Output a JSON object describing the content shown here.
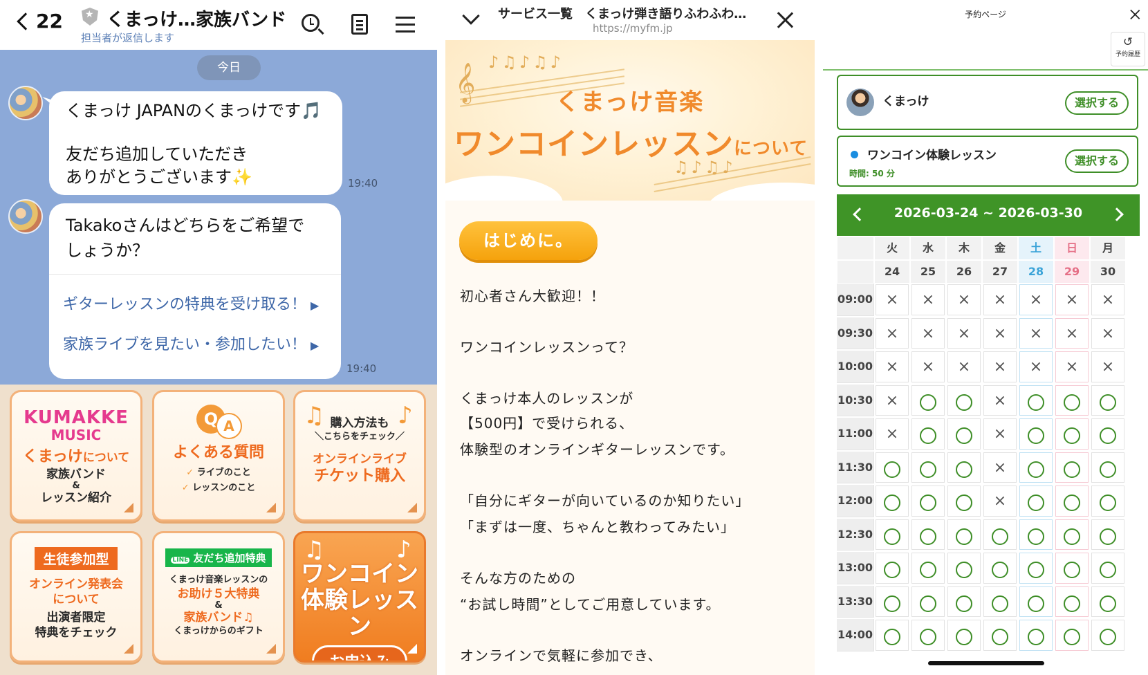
{
  "chat": {
    "unread_count": "22",
    "title": "くまっけ…家族バンド",
    "subtitle": "担当者が返信します",
    "date_label": "今日",
    "messages": [
      {
        "lines": [
          "くまっけ JAPANのくまっけです🎵",
          "友だち追加していただき",
          "ありがとうございます✨"
        ],
        "time": "19:40"
      },
      {
        "question_lines": [
          "Takakoさんはどちらをご希望で",
          "しょうか？"
        ],
        "options": [
          "ギターレッスンの特典を受け取る！",
          "家族ライブを見たい・参加したい！"
        ],
        "option_marker": "▶",
        "time": "19:40"
      }
    ],
    "rich_menu": {
      "tile1": {
        "brand": "KUMAKKE",
        "brand2": "MUSIC",
        "title": "くまっけ",
        "title_suffix": "について",
        "line1": "家族バンド",
        "amp": "&",
        "line2": "レッスン紹介"
      },
      "tile2": {
        "q": "Q",
        "a": "A",
        "title": "よくある質問",
        "item1": "ライブのこと",
        "item2": "レッスンのこと",
        "check": "✓"
      },
      "tile3": {
        "top1": "購入方法も",
        "top2": "＼こちらをチェック／",
        "line1": "オンラインライブ",
        "line2": "チケット購入"
      },
      "tile4": {
        "band": "生徒参加型",
        "line1": "オンライン発表会",
        "line2": "について",
        "line3": "出演者限定",
        "line4": "特典をチェック"
      },
      "tile5": {
        "band": "友だち追加特典",
        "band_icon": "LINE",
        "line1": "くまっけ音楽レッスンの",
        "line2": "お助け５大特典",
        "amp": "&",
        "line3": "家族バンド♫",
        "line4": "くまっけからのギフト"
      },
      "tile6": {
        "line1": "ワンコイン",
        "line2": "体験レッスン",
        "button": "お申込み"
      }
    }
  },
  "webview": {
    "title": "サービス一覧　くまっけ弾き語りふわふわ…",
    "url": "https://myfm.jp",
    "banner": {
      "sub": "くまっけ音楽",
      "main": "ワンコインレッスン",
      "main_suffix": "について"
    },
    "intro_button": "はじめに。",
    "paragraphs": [
      "初心者さん大歓迎！！",
      "ワンコインレッスンって？",
      "くまっけ本人のレッスンが",
      "【500円】で受けられる、",
      "体験型のオンラインギターレッスンです。",
      "「自分にギターが向いているのか知りたい」",
      "「まずは一度、ちゃんと教わってみたい」",
      "そんな方のための",
      "“お試し時間”としてご用意しています。",
      "オンラインで気軽に参加でき、"
    ]
  },
  "booking": {
    "title": "予約ページ",
    "history_label": "予約履歴",
    "staff_name": "くまっけ",
    "course_name": "ワンコイン体験レッスン",
    "course_time": "時間: 50 分",
    "select_label": "選択する",
    "week_range": "2026-03-24 ~ 2026-03-30",
    "days": [
      {
        "dow": "火",
        "date": "24",
        "type": "weekday"
      },
      {
        "dow": "水",
        "date": "25",
        "type": "weekday"
      },
      {
        "dow": "木",
        "date": "26",
        "type": "weekday"
      },
      {
        "dow": "金",
        "date": "27",
        "type": "weekday"
      },
      {
        "dow": "土",
        "date": "28",
        "type": "sat"
      },
      {
        "dow": "日",
        "date": "29",
        "type": "sun"
      },
      {
        "dow": "月",
        "date": "30",
        "type": "weekday"
      }
    ],
    "unavailable_mark": "×",
    "slots": [
      {
        "time": "09:00",
        "avail": [
          0,
          0,
          0,
          0,
          0,
          0,
          0
        ]
      },
      {
        "time": "09:30",
        "avail": [
          0,
          0,
          0,
          0,
          0,
          0,
          0
        ]
      },
      {
        "time": "10:00",
        "avail": [
          0,
          0,
          0,
          0,
          0,
          0,
          0
        ]
      },
      {
        "time": "10:30",
        "avail": [
          0,
          1,
          1,
          0,
          1,
          1,
          1
        ]
      },
      {
        "time": "11:00",
        "avail": [
          0,
          1,
          1,
          0,
          1,
          1,
          1
        ]
      },
      {
        "time": "11:30",
        "avail": [
          1,
          1,
          1,
          0,
          1,
          1,
          1
        ]
      },
      {
        "time": "12:00",
        "avail": [
          1,
          1,
          1,
          0,
          1,
          1,
          1
        ]
      },
      {
        "time": "12:30",
        "avail": [
          1,
          1,
          1,
          1,
          1,
          1,
          1
        ]
      },
      {
        "time": "13:00",
        "avail": [
          1,
          1,
          1,
          1,
          1,
          1,
          1
        ]
      },
      {
        "time": "13:30",
        "avail": [
          1,
          1,
          1,
          1,
          1,
          1,
          1
        ]
      },
      {
        "time": "14:00",
        "avail": [
          1,
          1,
          1,
          1,
          1,
          1,
          1
        ]
      }
    ]
  }
}
